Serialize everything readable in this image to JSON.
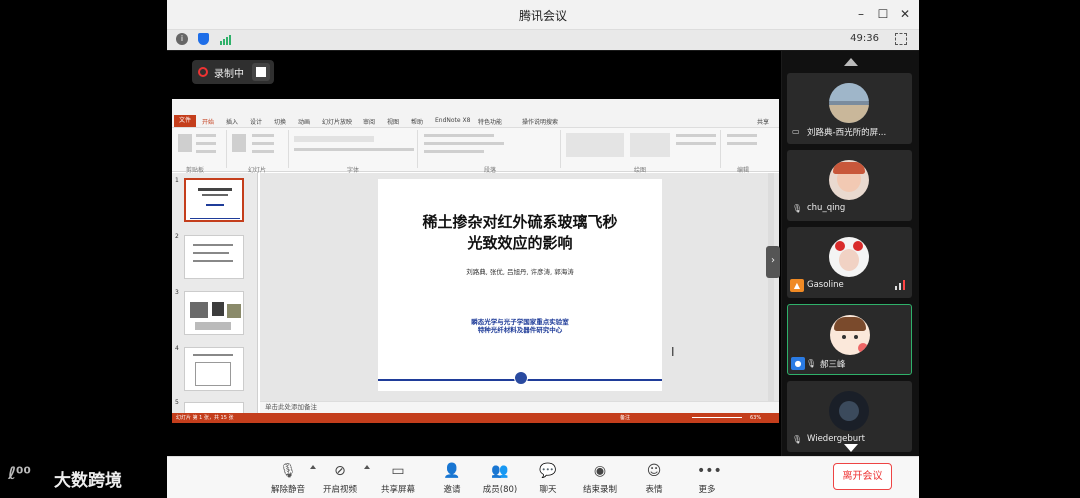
{
  "window": {
    "title": "腾讯会议",
    "timer": "49:36"
  },
  "recording": {
    "label": "录制中"
  },
  "ppt": {
    "file_tab": "文件",
    "tabs": [
      "开始",
      "插入",
      "设计",
      "切换",
      "动画",
      "幻灯片放映",
      "审阅",
      "视图",
      "帮助",
      "EndNote X8",
      "特色功能",
      "操作说明搜索"
    ],
    "share": "共享",
    "ribbon_groups": [
      "剪贴板",
      "幻灯片",
      "字体",
      "段落",
      "绘图",
      "编辑"
    ],
    "slide_numbers": [
      "1",
      "2",
      "3",
      "4",
      "5"
    ],
    "slide": {
      "title": "稀土掺杂对红外硫系玻璃飞秒\n光致效应的影响",
      "authors": "刘路典, 张优, 吕旭丹, 许彦涛, 郭海涛",
      "lab": "瞬态光学与光子学国家重点实验室\n特种光纤材料及器件研究中心"
    },
    "notes_placeholder": "单击此处添加备注",
    "status": {
      "left": "幻灯片 第 1 张，共 15 张",
      "notes": "备注",
      "zoom": "63%"
    }
  },
  "participants": [
    {
      "name": "刘路典-西光所的屏...",
      "mic": "muted"
    },
    {
      "name": "chu_qing",
      "mic": "muted"
    },
    {
      "name": "Gasoline",
      "mic": "on"
    },
    {
      "name": "郝三峰",
      "mic": "muted"
    },
    {
      "name": "Wiedergeburt",
      "mic": "muted"
    }
  ],
  "toolbar": {
    "mute": "解除静音",
    "video": "开启视频",
    "share": "共享屏幕",
    "invite": "邀请",
    "members": "成员(80)",
    "chat": "聊天",
    "stop_record": "结束录制",
    "reactions": "表情",
    "more": "更多",
    "leave": "离开会议"
  },
  "watermark": {
    "logo": "(ᵕᴗᵕ)",
    "text": "大数跨境"
  }
}
